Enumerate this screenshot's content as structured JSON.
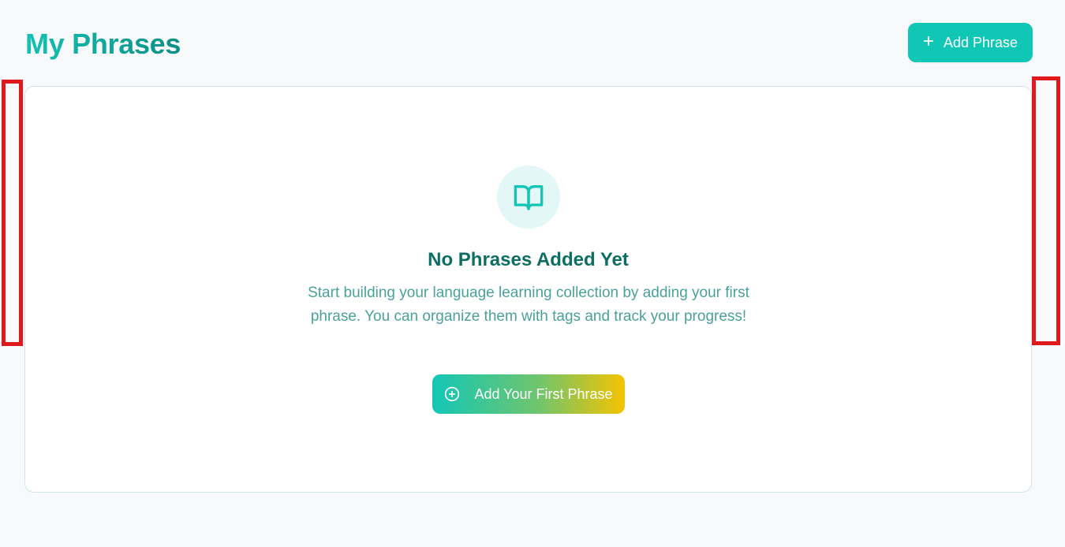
{
  "header": {
    "title": "My Phrases",
    "add_button_label": "Add Phrase"
  },
  "empty_state": {
    "icon": "book-open-icon",
    "title": "No Phrases Added Yet",
    "description": "Start building your language learning collection by adding your first phrase. You can organize them with tags and track your progress!",
    "cta_label": "Add Your First Phrase",
    "cta_icon": "plus-circle-icon"
  },
  "colors": {
    "accent": "#10c7b5",
    "title_dark": "#0d6e63",
    "description": "#4aa19a",
    "icon_bg": "#e2f7f6",
    "gradient_end": "#f5c300",
    "marker": "#e0191c"
  }
}
